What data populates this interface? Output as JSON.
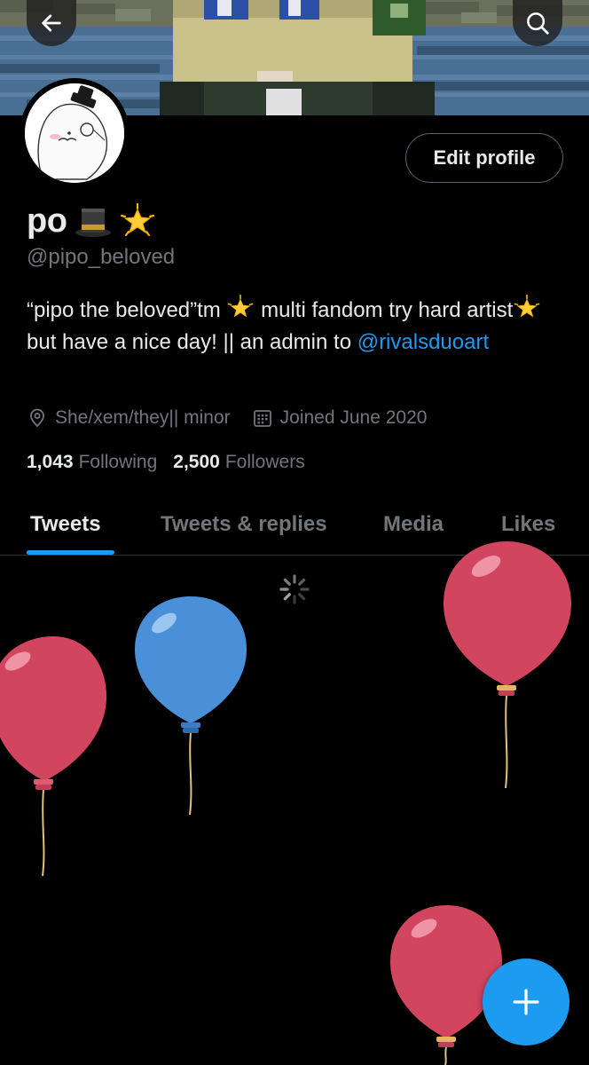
{
  "profile": {
    "display_name": "po",
    "name_emojis": [
      "top-hat-emoji",
      "glowing-star-emoji"
    ],
    "handle": "@pipo_beloved",
    "bio": {
      "part1": "“pipo the beloved”tm ",
      "part2": " multi fandom try hard artist",
      "part3": " but have a nice day! || an admin to ",
      "mention": "@rivalsduoart"
    },
    "pronouns": "She/xem/they|| minor",
    "joined": "Joined June 2020",
    "following_count": "1,043",
    "following_label": "Following",
    "followers_count": "2,500",
    "followers_label": "Followers"
  },
  "header": {
    "back_icon": "arrow-left-icon",
    "search_icon": "search-icon",
    "edit_profile_label": "Edit profile"
  },
  "tabs": [
    {
      "label": "Tweets",
      "active": true
    },
    {
      "label": "Tweets & replies",
      "active": false
    },
    {
      "label": "Media",
      "active": false
    },
    {
      "label": "Likes",
      "active": false
    }
  ],
  "feed": {
    "loading": true,
    "decorations": "birthday-balloons"
  },
  "fab": {
    "icon": "plus-icon"
  },
  "colors": {
    "accent": "#1d9bf0",
    "background": "#000000",
    "secondary_text": "#71767b",
    "balloon_red": "#d2455f",
    "balloon_blue": "#4a90d9"
  }
}
